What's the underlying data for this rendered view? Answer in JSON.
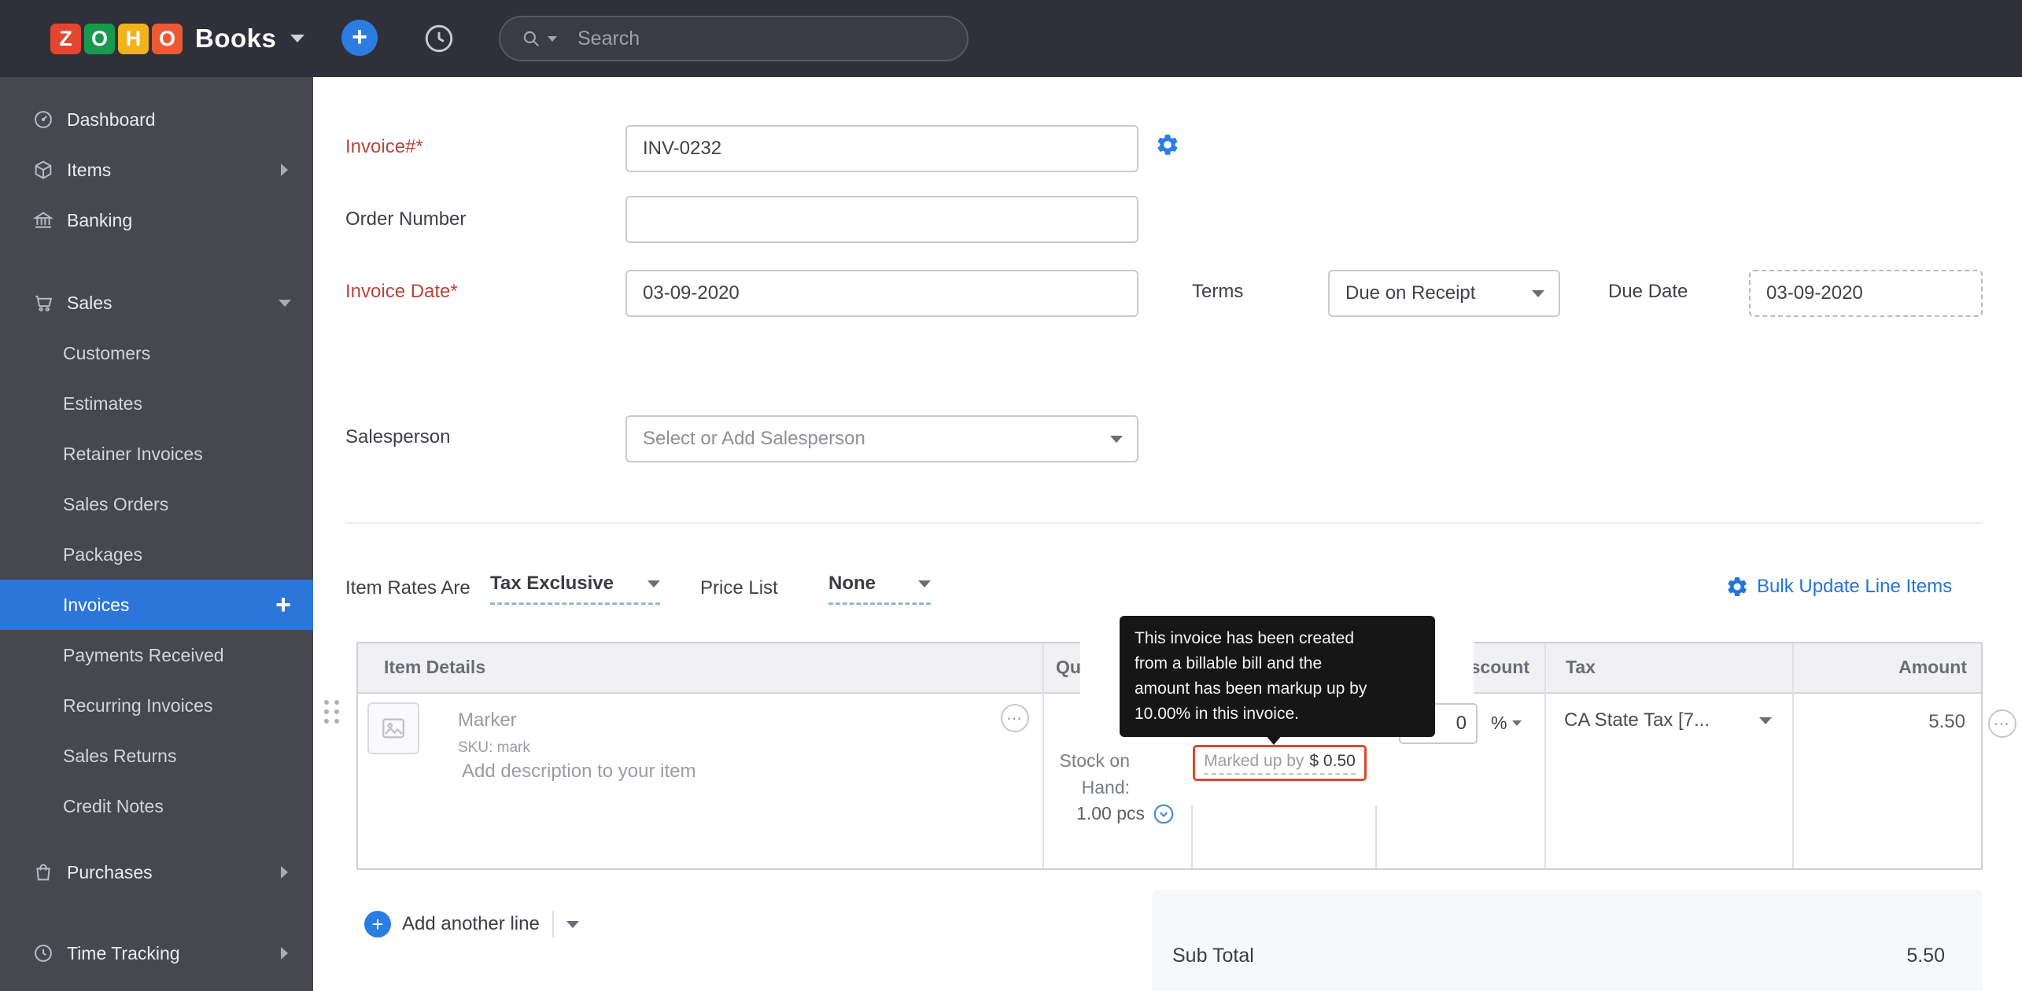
{
  "colors": {
    "accent_blue": "#2b7de1",
    "link_blue": "#2175d9",
    "active_nav_blue": "#2d76d9",
    "required_red": "#b6463c",
    "markup_border_red": "#e0452e",
    "logo_z": "#e4452f",
    "logo_o1": "#179a4e",
    "logo_h": "#f2b21c",
    "logo_o2": "#ec5a35"
  },
  "topbar": {
    "logo_letters": [
      "Z",
      "O",
      "H",
      "O"
    ],
    "brand": "Books",
    "search_placeholder": "Search"
  },
  "sidebar": {
    "dashboard": "Dashboard",
    "items": "Items",
    "banking": "Banking",
    "sales": "Sales",
    "customers": "Customers",
    "estimates": "Estimates",
    "retainer_invoices": "Retainer Invoices",
    "sales_orders": "Sales Orders",
    "packages": "Packages",
    "invoices": "Invoices",
    "payments_received": "Payments Received",
    "recurring_invoices": "Recurring Invoices",
    "sales_returns": "Sales Returns",
    "credit_notes": "Credit Notes",
    "purchases": "Purchases",
    "time_tracking": "Time Tracking"
  },
  "form": {
    "invoice_no_label": "Invoice#*",
    "invoice_no_value": "INV-0232",
    "order_label": "Order Number",
    "order_value": "",
    "date_label": "Invoice Date*",
    "date_value": "03-09-2020",
    "terms_label": "Terms",
    "terms_value": "Due on Receipt",
    "due_label": "Due Date",
    "due_value": "03-09-2020",
    "salesperson_label": "Salesperson",
    "salesperson_placeholder": "Select or Add Salesperson"
  },
  "line_items_bar": {
    "rates_label": "Item Rates Are",
    "rates_value": "Tax Exclusive",
    "price_list_label": "Price List",
    "price_list_value": "None",
    "bulk_update": "Bulk Update Line Items"
  },
  "table": {
    "headers": {
      "item_details": "Item Details",
      "quantity": "Quantity",
      "discount": "Discount",
      "tax": "Tax",
      "amount": "Amount"
    },
    "row": {
      "name": "Marker",
      "sku": "SKU: mark",
      "description_placeholder": "Add description to your item",
      "stock_line1": "Stock on",
      "stock_line2": "Hand:",
      "stock_value": "1.00 pcs",
      "discount_value": "0",
      "discount_unit": "%",
      "tax_value": "CA State Tax [7...",
      "amount": "5.50"
    }
  },
  "tooltip": {
    "line1": "This invoice has been created",
    "line2": "from a billable bill and the",
    "line3": "amount has been markup up by",
    "line4": "10.00% in this invoice.",
    "markup_label": "Marked up by",
    "markup_value": "$ 0.50"
  },
  "footer": {
    "add_line": "Add another line",
    "sub_total_label": "Sub Total",
    "sub_total_value": "5.50"
  }
}
